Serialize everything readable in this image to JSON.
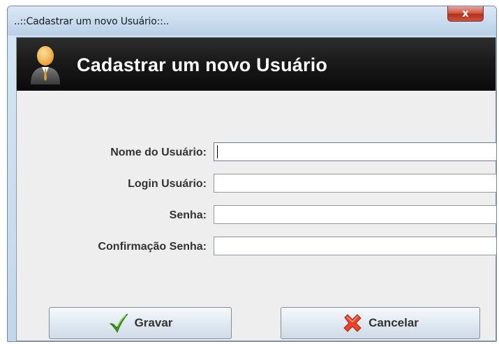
{
  "window": {
    "title": "..::Cadastrar um novo Usuário::..",
    "close_label": "x"
  },
  "header": {
    "title": "Cadastrar um novo Usuário",
    "icon": "user-icon"
  },
  "form": {
    "fields": [
      {
        "label": "Nome do Usuário:",
        "value": "",
        "placeholder": ""
      },
      {
        "label": "Login Usuário:",
        "value": "",
        "placeholder": ""
      },
      {
        "label": "Senha:",
        "value": "",
        "placeholder": ""
      },
      {
        "label": "Confirmação Senha:",
        "value": "",
        "placeholder": ""
      }
    ]
  },
  "buttons": {
    "save": {
      "label": "Gravar",
      "icon": "checkmark-icon",
      "color": "#3f9b1f"
    },
    "cancel": {
      "label": "Cancelar",
      "icon": "cross-icon",
      "color": "#e8452c"
    }
  }
}
